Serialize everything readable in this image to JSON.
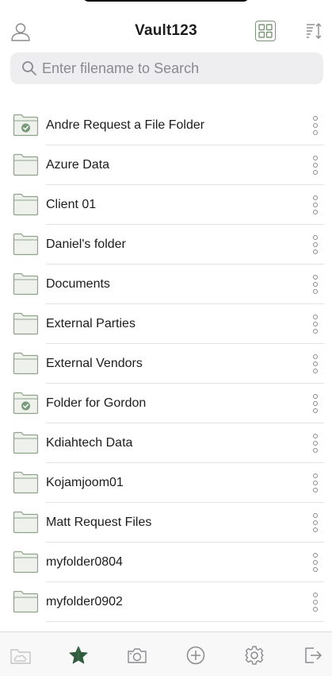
{
  "header": {
    "title": "Vault123",
    "user_icon": "user-icon",
    "grid_icon": "grid-view-icon",
    "sort_icon": "sort-icon"
  },
  "search": {
    "placeholder": "Enter filename to Search",
    "value": ""
  },
  "folders": [
    {
      "name": "Andre Request a File Folder",
      "shared": true
    },
    {
      "name": "Azure Data",
      "shared": false
    },
    {
      "name": "Client 01",
      "shared": false
    },
    {
      "name": "Daniel's folder",
      "shared": false
    },
    {
      "name": "Documents",
      "shared": false
    },
    {
      "name": "External Parties",
      "shared": false
    },
    {
      "name": "External Vendors",
      "shared": false
    },
    {
      "name": "Folder for Gordon",
      "shared": true
    },
    {
      "name": "Kdiahtech Data",
      "shared": false
    },
    {
      "name": "Kojamjoom01",
      "shared": false
    },
    {
      "name": "Matt Request Files",
      "shared": false
    },
    {
      "name": "myfolder0804",
      "shared": false
    },
    {
      "name": "myfolder0902",
      "shared": false
    }
  ],
  "tabbar": {
    "items": [
      {
        "icon": "cloud-folder-icon",
        "active": false
      },
      {
        "icon": "star-icon",
        "active": true
      },
      {
        "icon": "camera-icon",
        "active": false
      },
      {
        "icon": "add-circle-icon",
        "active": false
      },
      {
        "icon": "settings-gear-icon",
        "active": false
      },
      {
        "icon": "logout-icon",
        "active": false
      }
    ]
  },
  "colors": {
    "accent": "#2f5c3c",
    "icon_green": "#7a9478",
    "folder_fill": "#eef1ec",
    "folder_stroke": "#8ea38a",
    "badge": "#7b9a7c"
  }
}
